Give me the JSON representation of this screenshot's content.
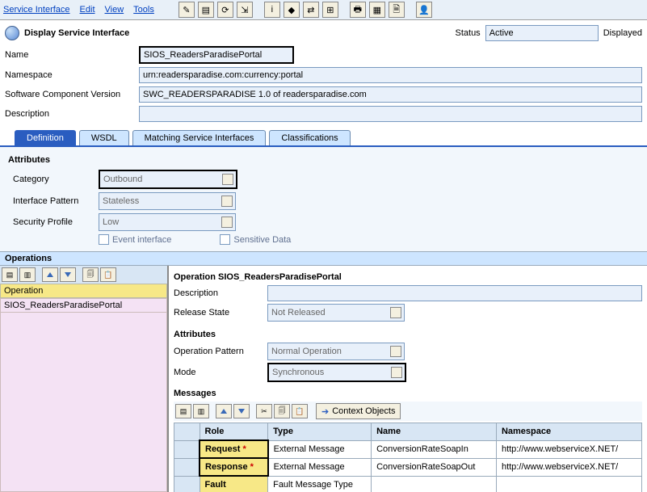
{
  "menu": {
    "items": [
      "Service Interface",
      "Edit",
      "View",
      "Tools"
    ]
  },
  "header": {
    "title": "Display Service Interface",
    "status_label": "Status",
    "status_value": "Active",
    "displayed_label": "Displayed"
  },
  "form": {
    "name_label": "Name",
    "name_value": "SIOS_ReadersParadisePortal",
    "ns_label": "Namespace",
    "ns_value": "urn:readersparadise.com:currency:portal",
    "swcv_label": "Software Component Version",
    "swcv_value": "SWC_READERSPARADISE 1.0 of readersparadise.com",
    "desc_label": "Description",
    "desc_value": ""
  },
  "tabs": [
    "Definition",
    "WSDL",
    "Matching Service Interfaces",
    "Classifications"
  ],
  "attrs": {
    "section": "Attributes",
    "category_label": "Category",
    "category_value": "Outbound",
    "pattern_label": "Interface Pattern",
    "pattern_value": "Stateless",
    "security_label": "Security Profile",
    "security_value": "Low",
    "event_label": "Event interface",
    "sensitive_label": "Sensitive Data"
  },
  "ops": {
    "section": "Operations",
    "col_header": "Operation",
    "row_value": "SIOS_ReadersParadisePortal",
    "detail_header": "Operation SIOS_ReadersParadisePortal",
    "desc_label": "Description",
    "desc_value": "",
    "release_label": "Release State",
    "release_value": "Not Released",
    "attr_section": "Attributes",
    "oppat_label": "Operation Pattern",
    "oppat_value": "Normal Operation",
    "mode_label": "Mode",
    "mode_value": "Synchronous",
    "msgs_section": "Messages",
    "context_btn": "Context Objects",
    "cols": [
      "Role",
      "Type",
      "Name",
      "Namespace"
    ],
    "rows": [
      {
        "role": "Request",
        "ast": "*",
        "type": "External Message",
        "name": "ConversionRateSoapIn",
        "ns": "http://www.webserviceX.NET/"
      },
      {
        "role": "Response",
        "ast": "*",
        "type": "External Message",
        "name": "ConversionRateSoapOut",
        "ns": "http://www.webserviceX.NET/"
      },
      {
        "role": "Fault",
        "ast": "",
        "type": "Fault Message Type",
        "name": "",
        "ns": ""
      }
    ]
  }
}
